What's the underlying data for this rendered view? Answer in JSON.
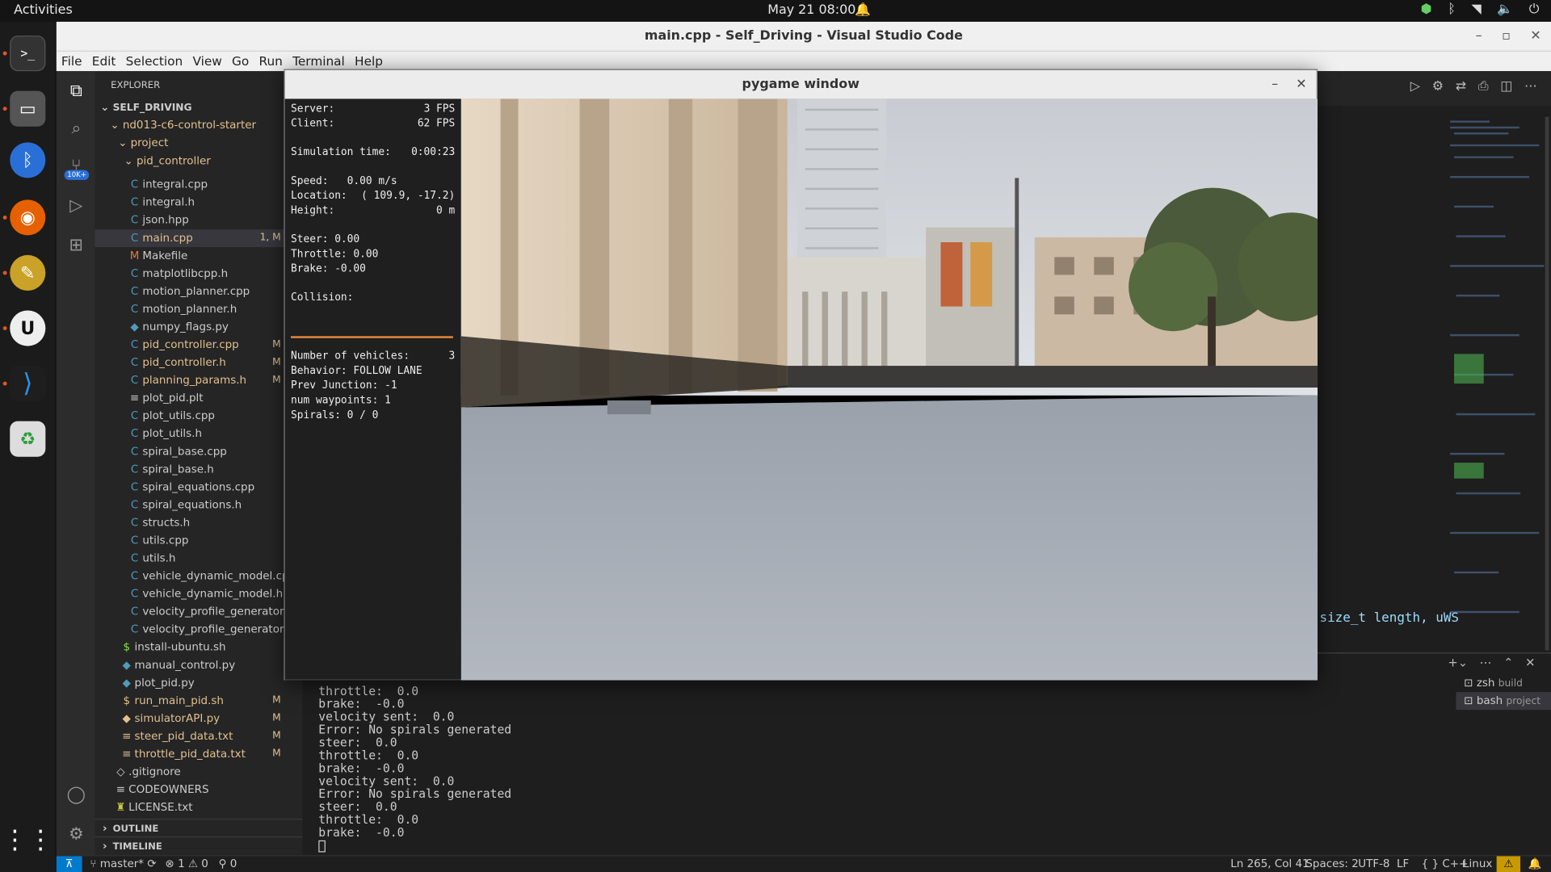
{
  "topbar": {
    "activities": "Activities",
    "clock": "May 21  08:00",
    "tray": [
      "●",
      "✱",
      "▲",
      "🔈",
      "⏻"
    ]
  },
  "vscode": {
    "title": "main.cpp - Self_Driving - Visual Studio Code",
    "menu": [
      "File",
      "Edit",
      "Selection",
      "View",
      "Go",
      "Run",
      "Terminal",
      "Help"
    ],
    "explorer_label": "EXPLORER",
    "root": "SELF_DRIVING",
    "folders": {
      "repo": "nd013-c6-control-starter",
      "project": "project",
      "pid": "pid_controller"
    },
    "files": [
      {
        "name": "integral.cpp",
        "icon": "C",
        "color": "#6c9ef8"
      },
      {
        "name": "integral.h",
        "icon": "C",
        "color": "#a074c4"
      },
      {
        "name": "json.hpp",
        "icon": "C",
        "color": "#a074c4"
      },
      {
        "name": "main.cpp",
        "icon": "C",
        "color": "#e2c08d",
        "badge": "1, M"
      },
      {
        "name": "Makefile",
        "icon": "M",
        "color": "#e37933"
      },
      {
        "name": "matplotlibcpp.h",
        "icon": "C",
        "color": "#a074c4"
      },
      {
        "name": "motion_planner.cpp",
        "icon": "C",
        "color": "#6c9ef8"
      },
      {
        "name": "motion_planner.h",
        "icon": "C",
        "color": "#a074c4"
      },
      {
        "name": "numpy_flags.py",
        "icon": "◆",
        "color": "#519aba"
      },
      {
        "name": "pid_controller.cpp",
        "icon": "C",
        "color": "#e2c08d",
        "badge": "M"
      },
      {
        "name": "pid_controller.h",
        "icon": "C",
        "color": "#e2c08d",
        "badge": "M"
      },
      {
        "name": "planning_params.h",
        "icon": "C",
        "color": "#e2c08d",
        "badge": "M"
      },
      {
        "name": "plot_pid.plt",
        "icon": "≡",
        "color": "#ccc"
      },
      {
        "name": "plot_utils.cpp",
        "icon": "C",
        "color": "#6c9ef8"
      },
      {
        "name": "plot_utils.h",
        "icon": "C",
        "color": "#a074c4"
      },
      {
        "name": "spiral_base.cpp",
        "icon": "C",
        "color": "#6c9ef8"
      },
      {
        "name": "spiral_base.h",
        "icon": "C",
        "color": "#a074c4"
      },
      {
        "name": "spiral_equations.cpp",
        "icon": "C",
        "color": "#6c9ef8"
      },
      {
        "name": "spiral_equations.h",
        "icon": "C",
        "color": "#a074c4"
      },
      {
        "name": "structs.h",
        "icon": "C",
        "color": "#a074c4"
      },
      {
        "name": "utils.cpp",
        "icon": "C",
        "color": "#6c9ef8"
      },
      {
        "name": "utils.h",
        "icon": "C",
        "color": "#a074c4"
      },
      {
        "name": "vehicle_dynamic_model.cpp",
        "icon": "C",
        "color": "#6c9ef8"
      },
      {
        "name": "vehicle_dynamic_model.h",
        "icon": "C",
        "color": "#a074c4"
      },
      {
        "name": "velocity_profile_generator.cpp",
        "icon": "C",
        "color": "#6c9ef8"
      },
      {
        "name": "velocity_profile_generator.h",
        "icon": "C",
        "color": "#a074c4"
      }
    ],
    "project_files": [
      {
        "name": "install-ubuntu.sh",
        "icon": "$",
        "color": "#89e051"
      },
      {
        "name": "manual_control.py",
        "icon": "◆",
        "color": "#519aba"
      },
      {
        "name": "plot_pid.py",
        "icon": "◆",
        "color": "#519aba"
      },
      {
        "name": "run_main_pid.sh",
        "icon": "$",
        "color": "#e2c08d",
        "badge": "M"
      },
      {
        "name": "simulatorAPI.py",
        "icon": "◆",
        "color": "#e2c08d",
        "badge": "M"
      },
      {
        "name": "steer_pid_data.txt",
        "icon": "≡",
        "color": "#e2c08d",
        "badge": "M"
      },
      {
        "name": "throttle_pid_data.txt",
        "icon": "≡",
        "color": "#e2c08d",
        "badge": "M"
      }
    ],
    "repo_files": [
      {
        "name": ".gitignore",
        "icon": "◇",
        "color": "#ccc"
      },
      {
        "name": "CODEOWNERS",
        "icon": "≡",
        "color": "#ccc"
      },
      {
        "name": "LICENSE.txt",
        "icon": "♜",
        "color": "#cbcb41"
      }
    ],
    "outline": "OUTLINE",
    "timeline": "TIMELINE",
    "code_fragment": "size_t length, uWS",
    "terminal_lines": [
      "throttle:  0.0",
      "brake:  -0.0",
      "velocity sent:  0.0",
      "Error: No spirals generated",
      "steer:  0.0",
      "throttle:  0.0",
      "brake:  -0.0",
      "velocity sent:  0.0",
      "Error: No spirals generated",
      "steer:  0.0",
      "throttle:  0.0",
      "brake:  -0.0"
    ],
    "terminals": [
      {
        "name": "zsh",
        "sub": "build"
      },
      {
        "name": "bash",
        "sub": "project"
      }
    ],
    "badge_count": "10K+",
    "status": {
      "branch": "master*",
      "errors": "1",
      "warnings": "0",
      "ports": "0",
      "position": "Ln 265, Col 41",
      "spaces": "Spaces: 2",
      "encoding": "UTF-8",
      "eol": "LF",
      "lang": "C++",
      "os": "Linux"
    }
  },
  "pygame": {
    "title": "pygame window",
    "hud": [
      {
        "k": "Server:",
        "v": "3 FPS"
      },
      {
        "k": "Client:",
        "v": "62 FPS"
      },
      {
        "k": "Simulation time:",
        "v": "0:00:23"
      },
      {
        "k": "Speed:   0.00 m/s",
        "v": ""
      },
      {
        "k": "Location:",
        "v": "( 109.9, -17.2)"
      },
      {
        "k": "Height:",
        "v": "0 m"
      },
      {
        "k": "Steer: 0.00",
        "v": ""
      },
      {
        "k": "Throttle: 0.00",
        "v": ""
      },
      {
        "k": "Brake: -0.00",
        "v": ""
      },
      {
        "k": "Collision:",
        "v": ""
      },
      {
        "k": "Number of vehicles:",
        "v": "3"
      },
      {
        "k": "Behavior: FOLLOW LANE",
        "v": ""
      },
      {
        "k": "Prev Junction: -1",
        "v": ""
      },
      {
        "k": "num waypoints: 1",
        "v": ""
      },
      {
        "k": "Spirals: 0 / 0",
        "v": ""
      }
    ]
  }
}
